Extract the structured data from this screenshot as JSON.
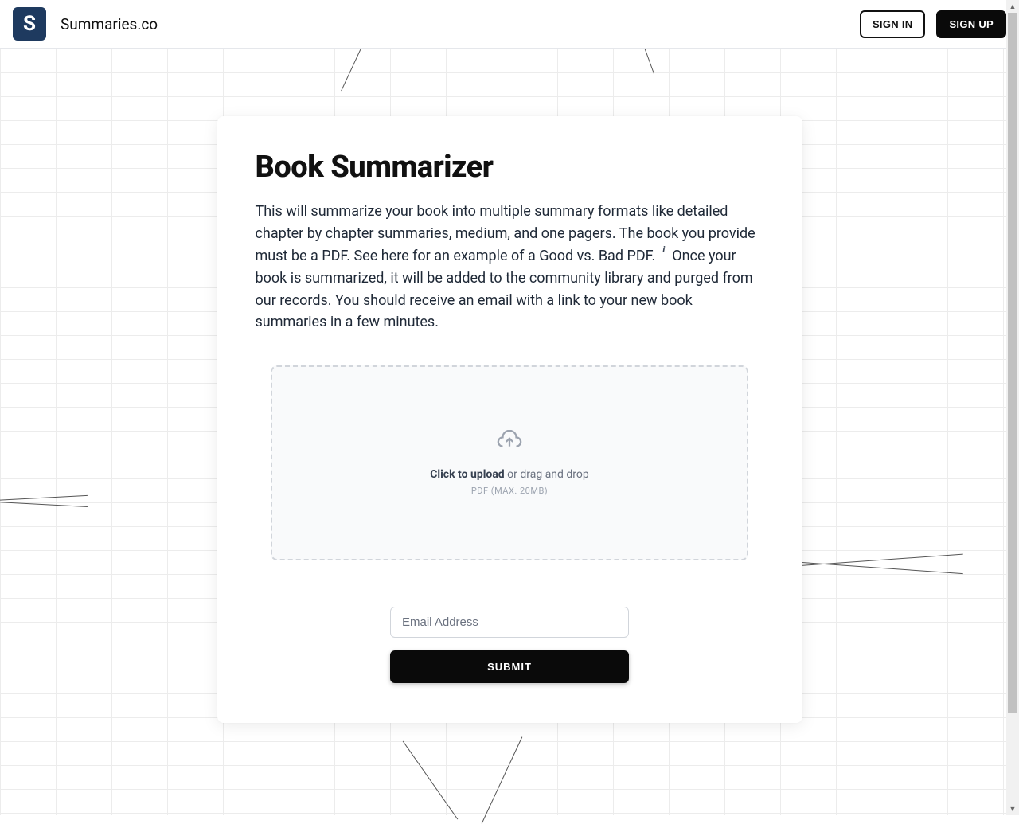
{
  "header": {
    "logo_letter": "S",
    "brand": "Summaries.co",
    "signin_label": "SIGN IN",
    "signup_label": "SIGN UP"
  },
  "main": {
    "title": "Book Summarizer",
    "description_part1": "This will summarize your book into multiple summary formats like detailed chapter by chapter summaries, medium, and one pagers. The book you provide must be a PDF. See here for an example of a Good vs. Bad PDF.",
    "description_part2": "Once your book is summarized, it will be added to the community library and purged from our records. You should receive an email with a link to your new book summaries in a few minutes."
  },
  "dropzone": {
    "upload_bold": "Click to upload",
    "upload_rest": " or drag and drop",
    "hint": "PDF (MAX. 20MB)"
  },
  "form": {
    "email_placeholder": "Email Address",
    "submit_label": "SUBMIT"
  }
}
